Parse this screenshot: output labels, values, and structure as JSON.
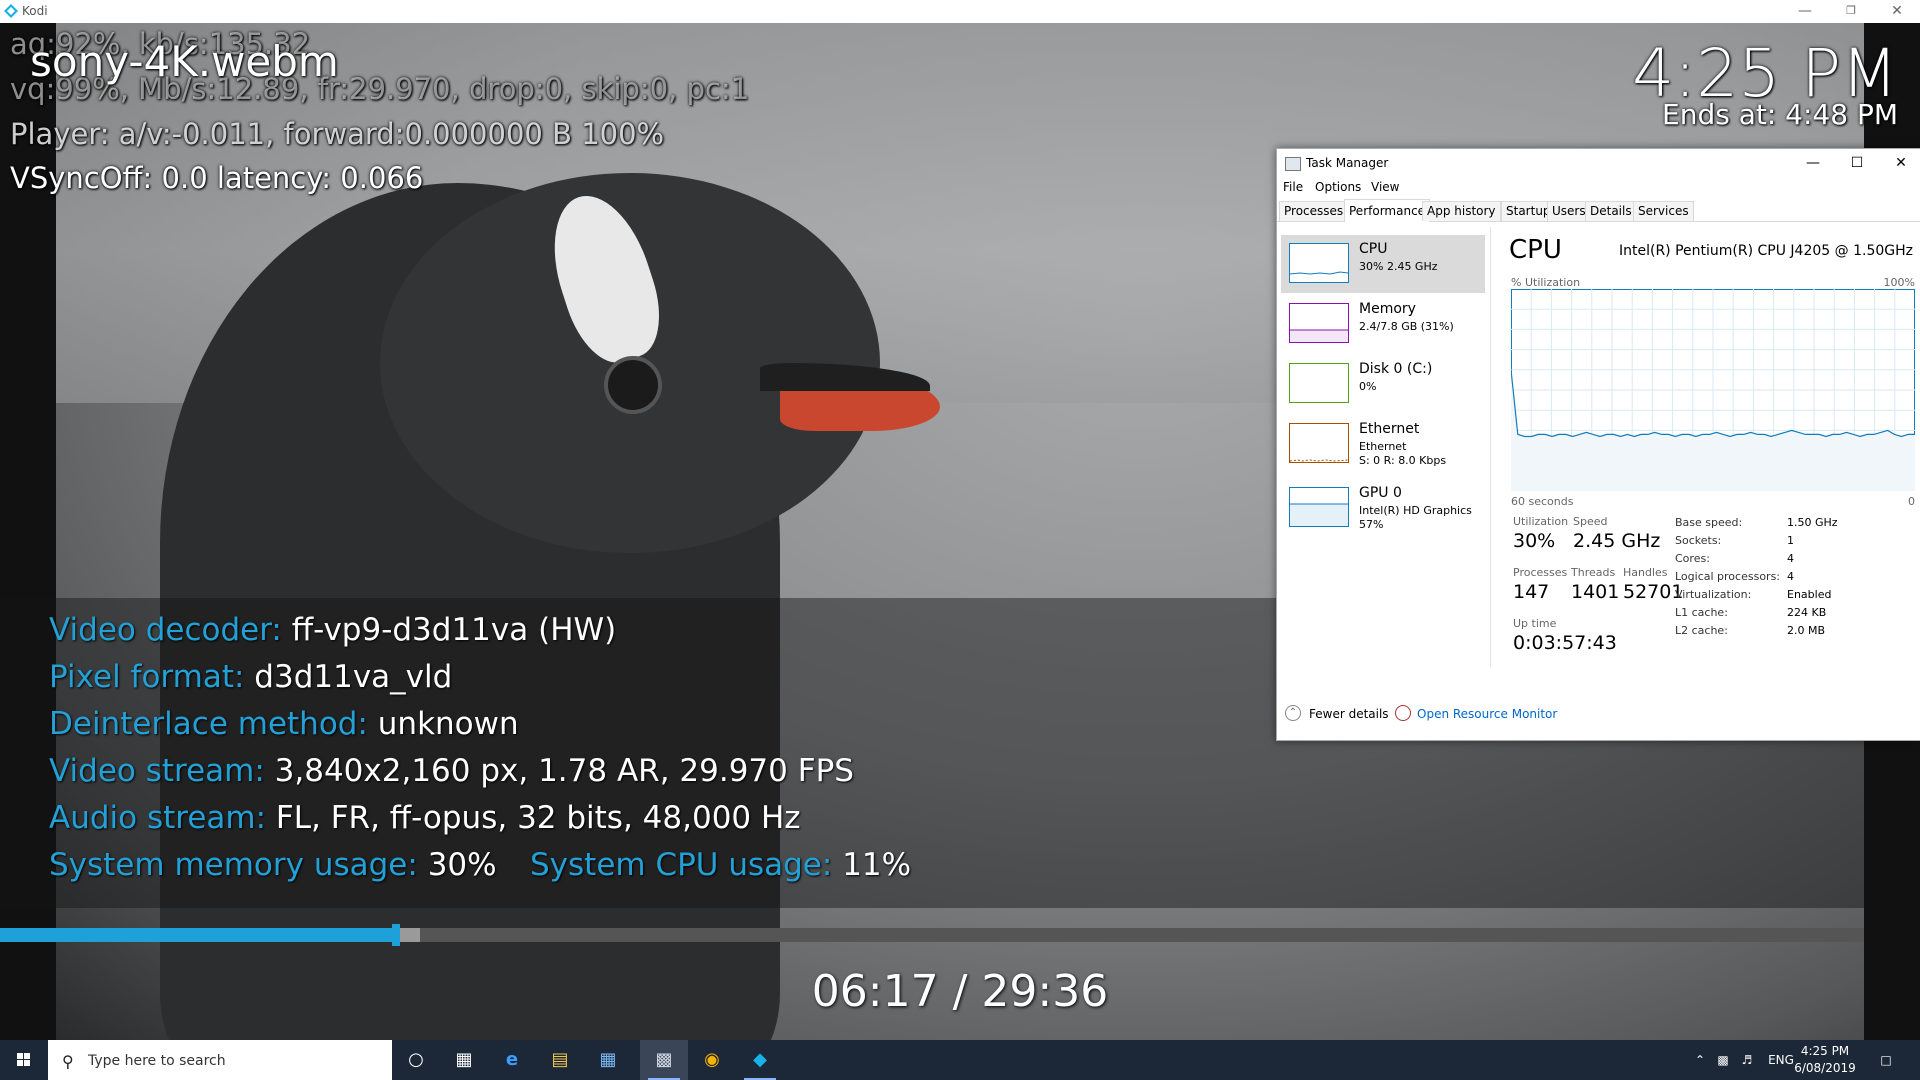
{
  "app": {
    "title": "Kodi"
  },
  "overlay": {
    "debug_lines": [
      "aq:92%, kb/s:135.32",
      "vq:99%, Mb/s:12.89, fr:29.970, drop:0, skip:0, pc:1",
      "Player: a/v:-0.011,  forward:0.000000 B 100%",
      "VSyncOff: 0.0 latency: 0.066"
    ],
    "media_title": "sony-4K.webm",
    "clock": "4:25 PM",
    "ends_at": "Ends at: 4:48 PM"
  },
  "info": {
    "rows": [
      {
        "label": "Video decoder:",
        "value": "ff-vp9-d3d11va (HW)"
      },
      {
        "label": "Pixel format:",
        "value": "d3d11va_vld"
      },
      {
        "label": "Deinterlace method:",
        "value": "unknown"
      },
      {
        "label": "Video stream:",
        "value": "3,840x2,160 px, 1.78 AR, 29.970 FPS"
      },
      {
        "label": "Audio stream:",
        "value": "FL, FR, ff-opus, 32 bits, 48,000 Hz"
      }
    ],
    "memory_label": "System memory usage:",
    "memory_value": "30%",
    "cpu_label": "System CPU usage:",
    "cpu_value": "11%",
    "label_color": "#23a0d6"
  },
  "playback": {
    "time": "06:17 / 29:36",
    "progress": 0.2123,
    "buffer": 0.2254
  },
  "taskmgr": {
    "title": "Task Manager",
    "menu": [
      "File",
      "Options",
      "View"
    ],
    "tabs": [
      "Processes",
      "Performance",
      "App history",
      "Startup",
      "Users",
      "Details",
      "Services"
    ],
    "active_tab": "Performance",
    "resources": [
      {
        "name": "CPU",
        "sub1": "30%  2.45 GHz",
        "sub2": "",
        "color": "#117dbb"
      },
      {
        "name": "Memory",
        "sub1": "2.4/7.8 GB (31%)",
        "sub2": "",
        "color": "#8b12ae"
      },
      {
        "name": "Disk 0 (C:)",
        "sub1": "0%",
        "sub2": "",
        "color": "#4da60c"
      },
      {
        "name": "Ethernet",
        "sub1": "Ethernet",
        "sub2": "S: 0  R: 8.0 Kbps",
        "color": "#a74f01"
      },
      {
        "name": "GPU 0",
        "sub1": "Intel(R) HD Graphics",
        "sub2": "57%",
        "color": "#117dbb"
      }
    ],
    "cpu": {
      "title": "CPU",
      "model": "Intel(R) Pentium(R) CPU J4205 @ 1.50GHz",
      "util_label": "% Utilization",
      "util_max": "100%",
      "time_span": "60 seconds",
      "time_zero": "0",
      "graph_samples": [
        60,
        28,
        27,
        27,
        28,
        28,
        27,
        28,
        28,
        27,
        28,
        29,
        28,
        27,
        28,
        28,
        27,
        28,
        27,
        28,
        28,
        29,
        28,
        28,
        27,
        28,
        28,
        27,
        28,
        28,
        29,
        28,
        27,
        28,
        28,
        29,
        28,
        28,
        27,
        28,
        29,
        30,
        29,
        28,
        28,
        28,
        27,
        28,
        28,
        29,
        28,
        27,
        28,
        28,
        29,
        30,
        28,
        27,
        28,
        28
      ],
      "utilization_label": "Utilization",
      "utilization": "30%",
      "speed_label": "Speed",
      "speed": "2.45 GHz",
      "processes_label": "Processes",
      "processes": "147",
      "threads_label": "Threads",
      "threads": "1401",
      "handles_label": "Handles",
      "handles": "52701",
      "uptime_label": "Up time",
      "uptime": "0:03:57:43",
      "specs": [
        {
          "k": "Base speed:",
          "v": "1.50 GHz"
        },
        {
          "k": "Sockets:",
          "v": "1"
        },
        {
          "k": "Cores:",
          "v": "4"
        },
        {
          "k": "Logical processors:",
          "v": "4"
        },
        {
          "k": "Virtualization:",
          "v": "Enabled"
        },
        {
          "k": "L1 cache:",
          "v": "224 KB"
        },
        {
          "k": "L2 cache:",
          "v": "2.0 MB"
        }
      ]
    },
    "fewer_details": "Fewer details",
    "open_resource_monitor": "Open Resource Monitor"
  },
  "taskbar": {
    "search_placeholder": "Type here to search",
    "lang": "ENG",
    "time": "4:25 PM",
    "date": "6/08/2019"
  }
}
